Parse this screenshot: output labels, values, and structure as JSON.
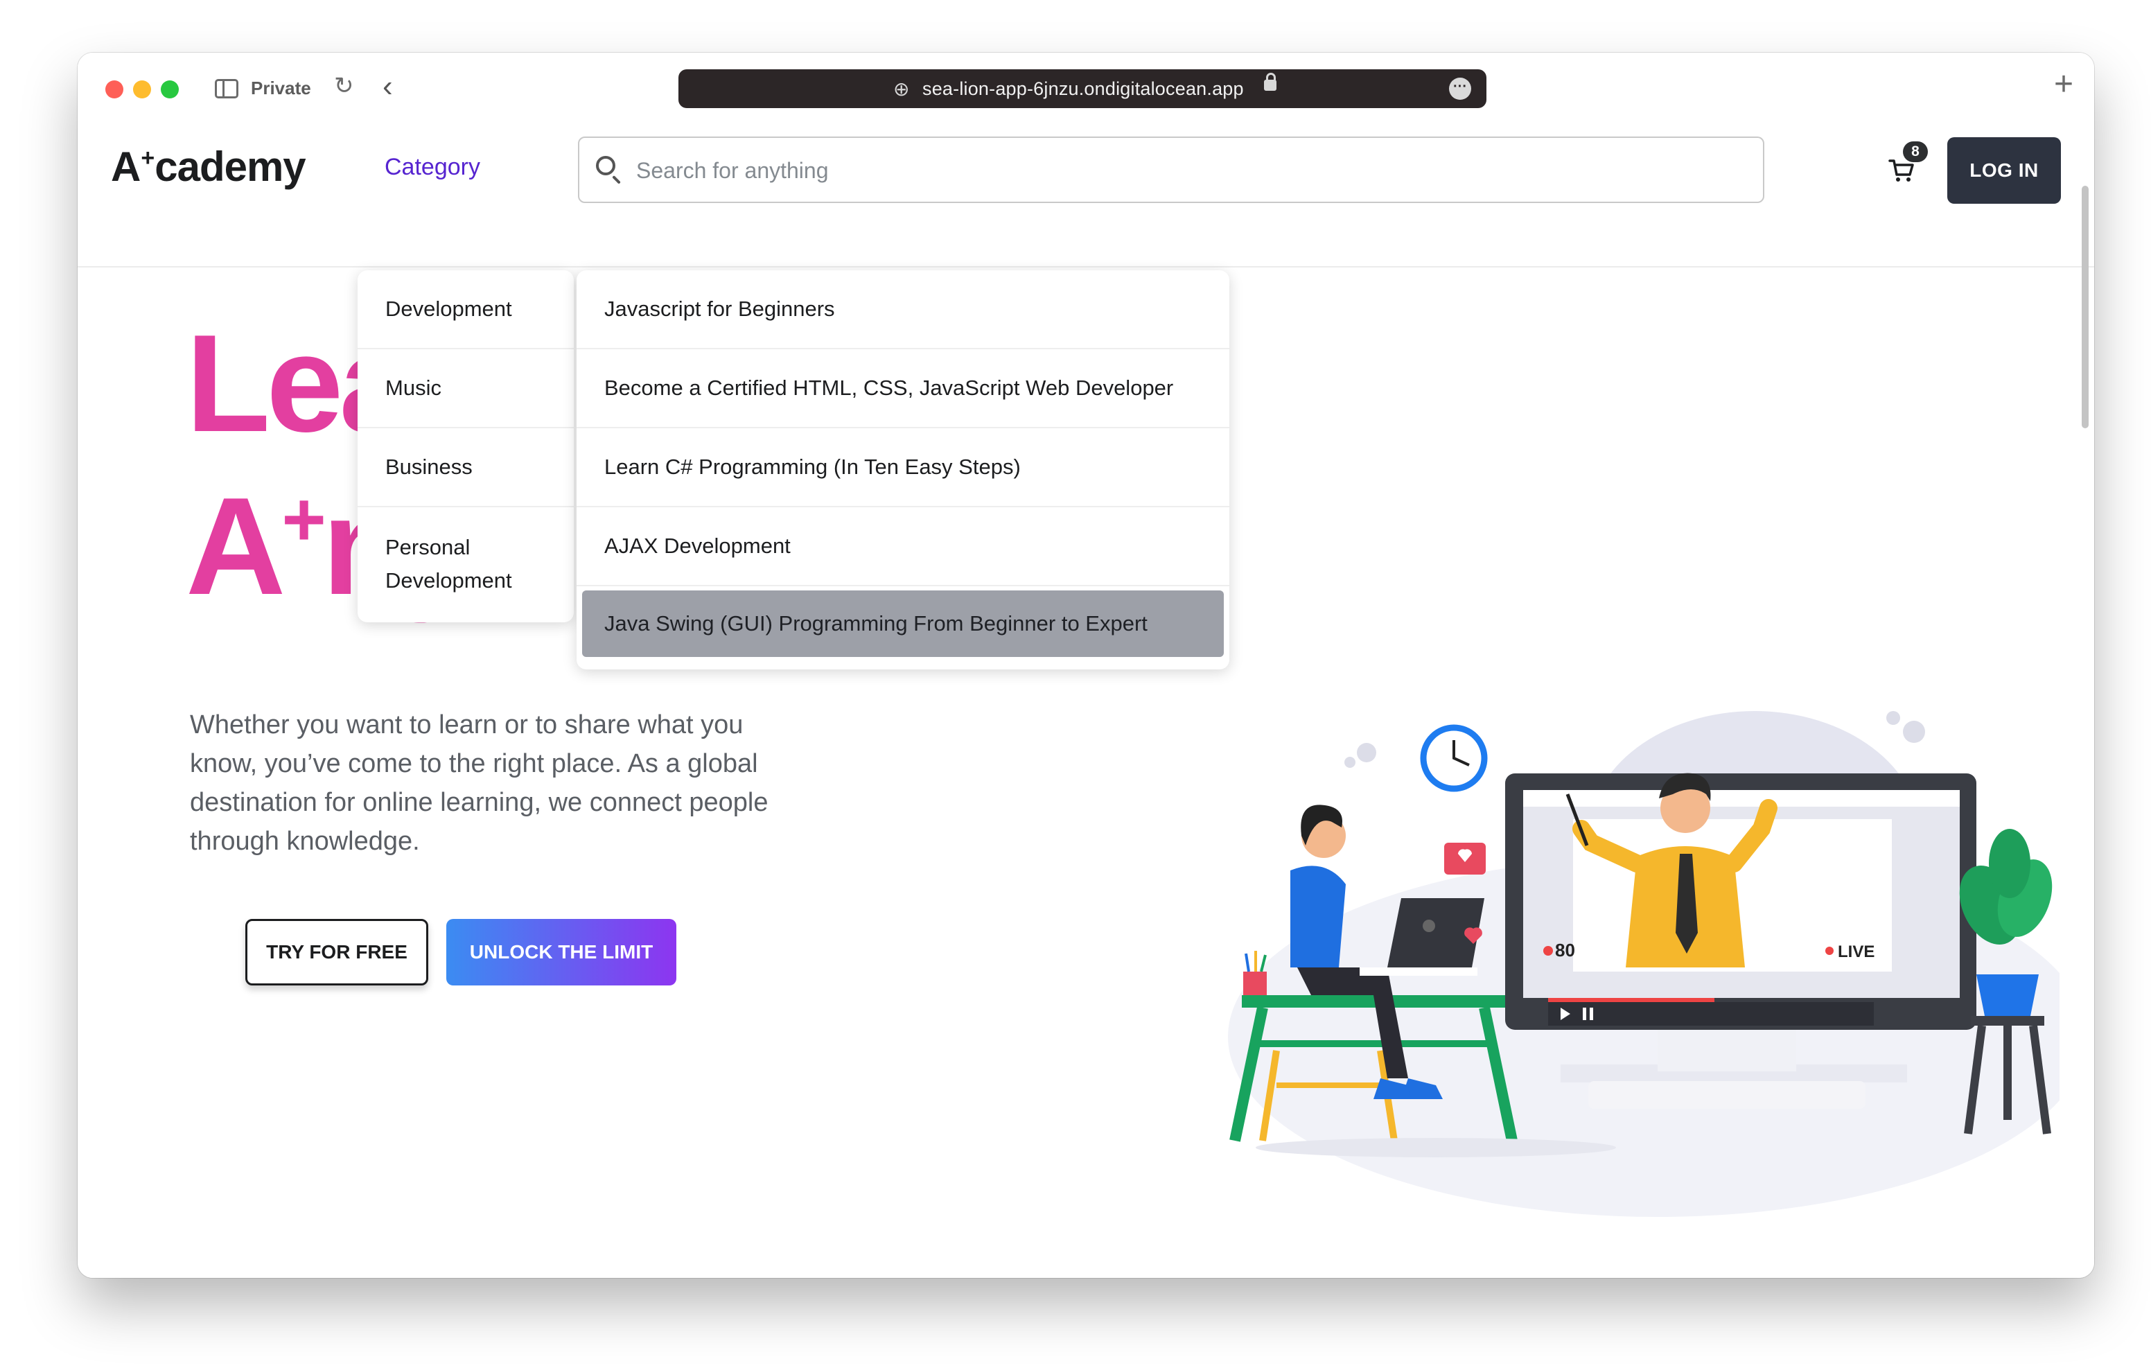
{
  "browser": {
    "private_label": "Private",
    "url": "sea-lion-app-6jnzu.ondigitalocean.app"
  },
  "navbar": {
    "logo": {
      "prefix": "A",
      "sup": "+",
      "suffix": "cademy"
    },
    "category_label": "Category",
    "search_placeholder": "Search for anything",
    "cart_count": "8",
    "login_label": "LOG IN"
  },
  "hero": {
    "title_line1": "Lea",
    "title_line2_prefix": "A",
    "title_line2_sup": "+",
    "title_line2_rest": "ny",
    "description": "Whether you want to learn or to share what you know, you’ve come to the right place. As a global destination for online learning, we connect people through knowledge.",
    "btn_try": "TRY FOR FREE",
    "btn_unlock": "UNLOCK THE LIMIT"
  },
  "dropdown": {
    "categories": [
      "Development",
      "Music",
      "Business",
      "Personal Development"
    ],
    "courses": [
      "Javascript for Beginners",
      "Become a Certified HTML, CSS, JavaScript Web Developer",
      "Learn C# Programming (In Ten Easy Steps)",
      "AJAX Development",
      "Java Swing (GUI) Programming From Beginner to Expert"
    ],
    "active_course_index": 4
  },
  "illustration": {
    "viewers_count": "80",
    "live_label": "LIVE"
  },
  "colors": {
    "brand_pink": "#e33fa0",
    "category_purple": "#5624d0",
    "unlock_gradient_start": "#3b8cf2",
    "unlock_gradient_end": "#8d35f0",
    "login_bg": "#2d3340"
  }
}
